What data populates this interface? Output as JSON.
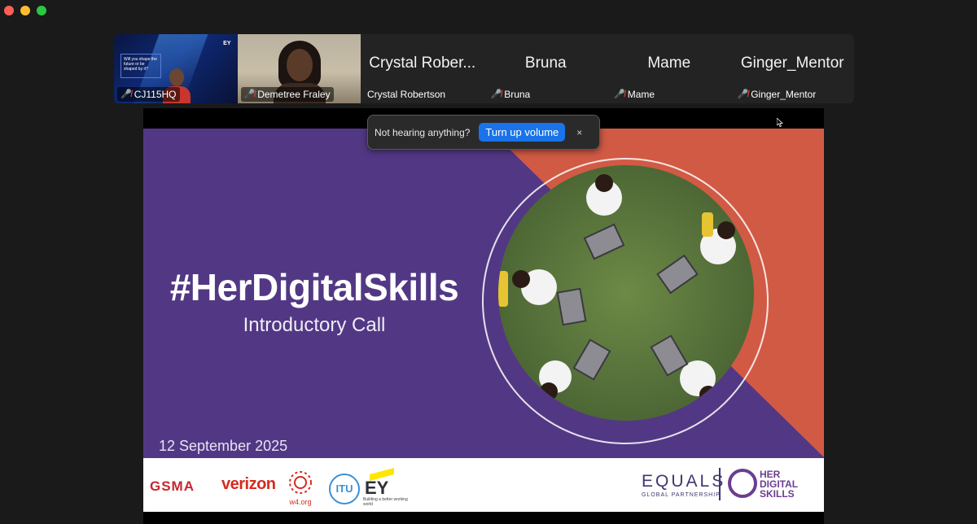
{
  "window": {
    "traffic_lights": [
      "#fe5f57",
      "#febc2e",
      "#28c840"
    ]
  },
  "participants": [
    {
      "display_name": "",
      "label": "CJ115HQ",
      "muted": true,
      "has_video": true
    },
    {
      "display_name": "",
      "label": "Demetree Fraley",
      "muted": true,
      "has_video": true
    },
    {
      "display_name": "Crystal Rober...",
      "label": "Crystal Robertson",
      "muted": false,
      "has_video": false
    },
    {
      "display_name": "Bruna",
      "label": "Bruna",
      "muted": true,
      "has_video": false
    },
    {
      "display_name": "Mame",
      "label": "Mame",
      "muted": true,
      "has_video": false
    },
    {
      "display_name": "Ginger_Mentor",
      "label": "Ginger_Mentor",
      "muted": true,
      "has_video": false
    }
  ],
  "video_tile_1": {
    "slide_text": "Will you shape the future or be shaped by it?",
    "logo": "EY"
  },
  "toast": {
    "message": "Not hearing anything?",
    "button": "Turn up volume",
    "close": "×"
  },
  "slide": {
    "title": "#HerDigitalSkills",
    "subtitle": "Introductory Call",
    "date": "12 September 2025",
    "colors": {
      "purple": "#523884",
      "orange": "#d15a45"
    }
  },
  "logos": {
    "gsma": "GSMA",
    "verizon": "verizon",
    "w4": "w4.org",
    "itu": "ITU",
    "ey": "EY",
    "ey_tagline": "Building a better working world",
    "equals": "EQUALS",
    "equals_sub": "GLOBAL PARTNERSHIP",
    "hds_line1": "HER",
    "hds_line2": "DIGITAL",
    "hds_line3": "SKILLS"
  }
}
